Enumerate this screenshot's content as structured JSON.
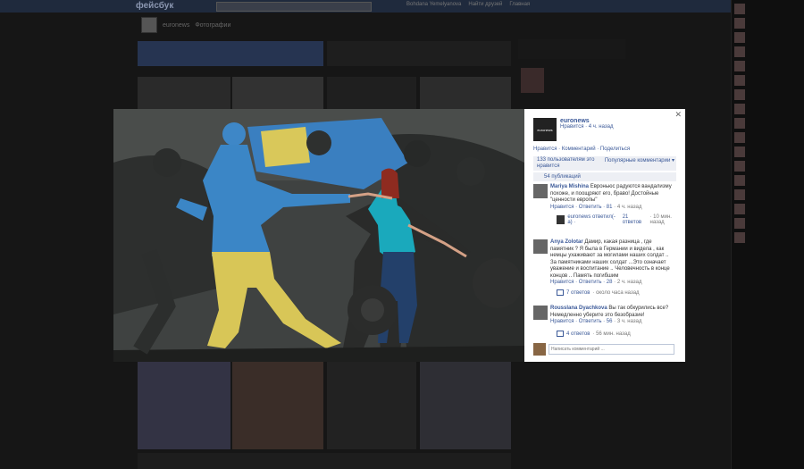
{
  "topbar": {
    "logo": "фейсбук",
    "nav": [
      "Bohdana Yemelyanova",
      "Найти друзей",
      "Главная"
    ]
  },
  "page": {
    "name": "euronews",
    "section": "Фотографии"
  },
  "photo_sidebar": {
    "owner_name": "euronews",
    "owner_avatar_text": "euronews",
    "owner_meta": "Нравится · 4 ч. назад",
    "actions": "Нравится · Комментарий · Поделиться",
    "likes_text": "133 пользователям это нравится",
    "sort_label": "Популярные комментарии ▾",
    "shares_text": "54 публикаций",
    "comments": [
      {
        "author": "Mariya Mishina",
        "text": "Евроньюс радуются вандализму похоже, и поощряют его, браво! Достойные \"ценности европы\"",
        "actions": "Нравится · Ответить · ",
        "likes": "81",
        "time": " · 4 ч. назад"
      },
      {
        "author": "Anya Zolotar",
        "text": "Дамир, какая разница , где памятник ? Я была в Германии и видела , как немцы ухаживают за могилами наших солдат .. За памятниками наших солдат ...Это означает уважение и воспитание .. Человечность в конце концов .. Память погибшим",
        "actions": "Нравится · Ответить · ",
        "likes": "28",
        "time": " · 2 ч. назад"
      },
      {
        "author": "Rousslana Dyachkova",
        "text": "Вы так обкурились все? Немедленно уберите это безобразие!",
        "actions": "Нравится · Ответить · ",
        "likes": "56",
        "time": " · 3 ч. назад"
      }
    ],
    "reply_1": {
      "who": "euronews ответил(-а) · ",
      "count": "21 ответов",
      "time": " · 10 мин. назад"
    },
    "reply_2": {
      "count": "7 ответов",
      "time": " · около часа назад"
    },
    "reply_3": {
      "count": "4 ответов",
      "time": " · 56 мин. назад"
    },
    "composer_placeholder": "Написать комментарий ..."
  },
  "colors": {
    "link": "#3b5998",
    "statue_blue": "#3b86c6",
    "statue_yellow": "#d9c85a",
    "teal_top": "#18a4b8"
  }
}
